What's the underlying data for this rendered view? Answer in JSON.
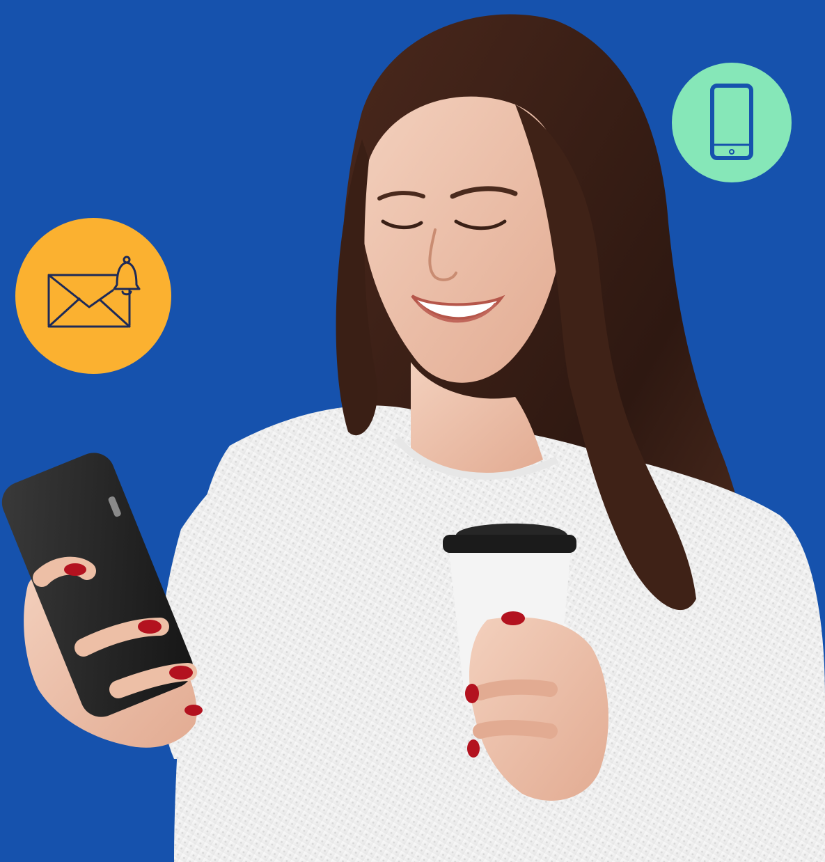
{
  "scene": {
    "background_color": "#1652ad",
    "subject": "woman-holding-phone-and-coffee-cup"
  },
  "badges": {
    "mail": {
      "icon": "mail-bell-icon",
      "color": "#fbb130",
      "stroke": "#1d2a57"
    },
    "phone": {
      "icon": "mobile-phone-icon",
      "color": "#86e7b8",
      "stroke": "#1652ad"
    }
  },
  "colors": {
    "hair": "#3b2017",
    "skin": "#efc4ad",
    "sweater": "#f2f2f2",
    "nails": "#b3121f",
    "phone_device": "#232323",
    "cup": "#f4f4f4",
    "cup_lid": "#1b1b1b"
  }
}
